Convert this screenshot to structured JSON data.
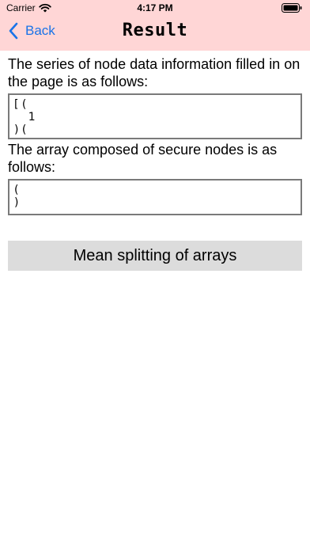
{
  "status_bar": {
    "carrier": "Carrier",
    "time": "4:17 PM"
  },
  "nav": {
    "back_label": "Back",
    "title": "Result"
  },
  "section1": {
    "label": "The series of node data information filled in on the page is as follows:",
    "value": "[ (\n    1\n) ("
  },
  "section2": {
    "label": "The array composed of secure nodes is as follows:",
    "value": "(\n)"
  },
  "actions": {
    "split_label": "Mean splitting of arrays"
  },
  "colors": {
    "nav_background": "#ffd6d6",
    "accent": "#1a73e8",
    "button_background": "#dcdcdc"
  },
  "icons": {
    "wifi": "wifi-icon",
    "battery": "battery-icon",
    "back": "chevron-left-icon"
  }
}
